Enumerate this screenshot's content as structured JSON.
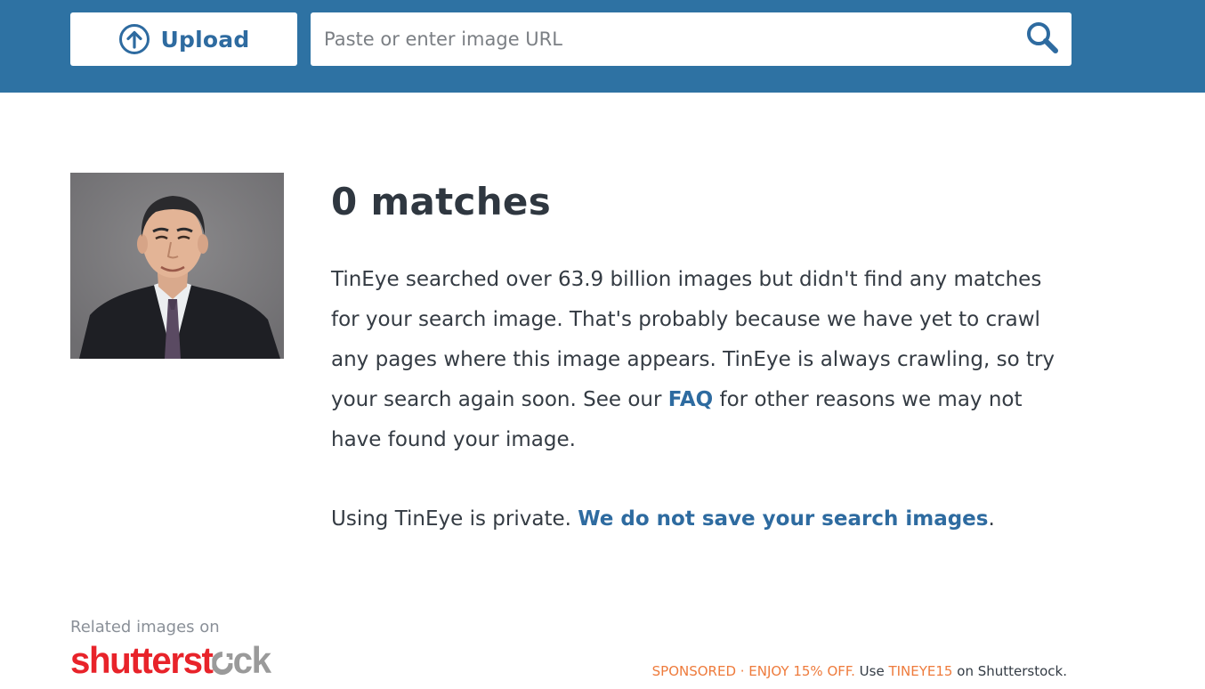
{
  "header": {
    "upload_label": "Upload",
    "url_placeholder": "Paste or enter image URL",
    "upload_icon": "upload-arrow-icon",
    "search_icon": "search-icon"
  },
  "result": {
    "title": "0 matches",
    "desc_before_link": "TinEye searched over 63.9 billion images but didn't find any matches for your search image. That's probably because we have yet to crawl any pages where this image appears. TinEye is always crawling, so try your search again soon. See our ",
    "faq_link": "FAQ",
    "desc_after_link": " for other reasons we may not have found your image.",
    "privacy_before": "Using TinEye is private. ",
    "privacy_link": "We do not save your search images",
    "privacy_after": "."
  },
  "footer": {
    "related_label": "Related images on",
    "brand_part1": "shutterst",
    "brand_part2": "ck",
    "sponsor_text": "SPONSORED · ENJOY 15% OFF.",
    "use_text": "Use",
    "code": "TINEYE15",
    "on_text": "on Shutterstock."
  },
  "colors": {
    "header_bg": "#2e72a3",
    "link": "#2e6ba0",
    "brand_red": "#e8232a",
    "sponsor_orange": "#ee7b3c"
  }
}
